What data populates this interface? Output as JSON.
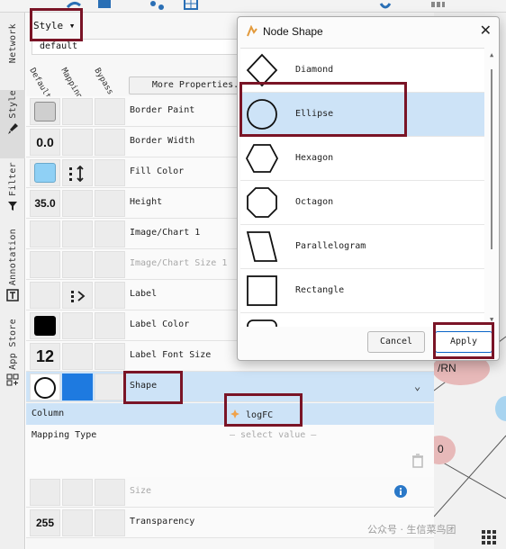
{
  "vertical_tabs": [
    {
      "label": "Network",
      "icon": "network-icon"
    },
    {
      "label": "Style",
      "icon": "brush-icon"
    },
    {
      "label": "Filter",
      "icon": "filter-icon"
    },
    {
      "label": "Annotation",
      "icon": "annotation-icon"
    },
    {
      "label": "App Store",
      "icon": "app-store-icon"
    }
  ],
  "style_panel": {
    "style_dropdown": "Style",
    "style_name": "default",
    "column_headers": [
      "Default",
      "Mapping",
      "Bypass"
    ],
    "more_properties": "More Properties...",
    "rows": [
      {
        "property": "Border Paint"
      },
      {
        "property": "Border Width",
        "default": "0.0"
      },
      {
        "property": "Fill Color"
      },
      {
        "property": "Height",
        "default": "35.0"
      },
      {
        "property": "Image/Chart 1"
      },
      {
        "property": "Image/Chart Size 1"
      },
      {
        "property": "Label"
      },
      {
        "property": "Label Color"
      },
      {
        "property": "Label Font Size",
        "default": "12"
      },
      {
        "property": "Shape"
      }
    ],
    "mapping": {
      "column_label": "Column",
      "column_value": "logFC",
      "mapping_type_label": "Mapping Type",
      "mapping_type_placeholder": "— select value —"
    },
    "lower_rows": [
      {
        "property": "Size"
      },
      {
        "property": "Transparency",
        "default": "255"
      }
    ]
  },
  "graph_labels": [
    "/RN",
    "0"
  ],
  "dialog": {
    "title": "Node Shape",
    "close": "✕",
    "shapes": [
      "Diamond",
      "Ellipse",
      "Hexagon",
      "Octagon",
      "Parallelogram",
      "Rectangle"
    ],
    "selected": "Ellipse",
    "cancel_label": "Cancel",
    "apply_label": "Apply"
  },
  "watermark": "公众号 · 生信菜鸟团",
  "colors": {
    "accent": "#7a1426",
    "selection": "#cde3f7",
    "fill_color_swatch": "#8fd0f5",
    "shape_bypass": "#1e7ae0"
  }
}
